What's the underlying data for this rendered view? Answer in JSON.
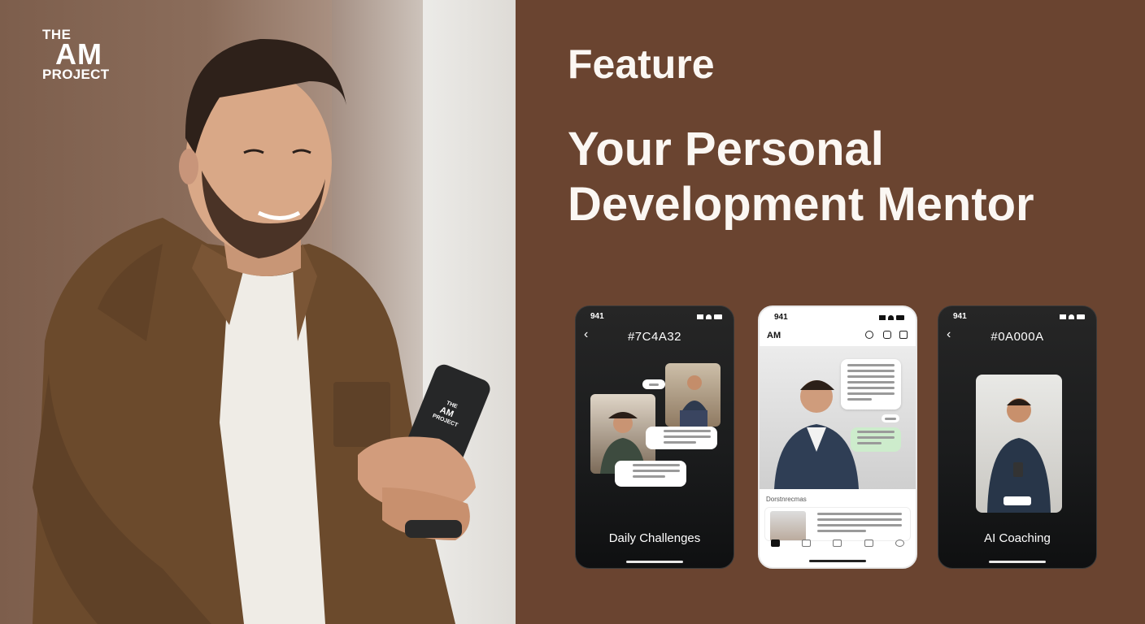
{
  "brand": {
    "line1": "THE",
    "line2": "AM",
    "line3": "PROJECT"
  },
  "phone_case_text": {
    "line1": "THE",
    "line2": "AM",
    "line3": "PROJECT"
  },
  "heading": {
    "kicker": "Feature",
    "title": "Your Personal Development Mentor"
  },
  "phones": [
    {
      "time": "941",
      "title": "#7C4A32",
      "caption": "Daily Challenges",
      "theme": "dark"
    },
    {
      "time": "941",
      "app_title": "AM",
      "section": "Dorstnrecmas",
      "theme": "light"
    },
    {
      "time": "941",
      "title": "#0A000A",
      "caption": "AI Coaching",
      "theme": "dark"
    }
  ],
  "colors": {
    "background": "#6a4430",
    "phone_dark": "#1b1c1d",
    "chat_green": "#cdeccc",
    "text": "#fbf7f3"
  },
  "icons": [
    "back-chevron-icon",
    "search-icon",
    "instagram-icon",
    "share-icon",
    "home-icon",
    "signal-icon",
    "wifi-icon",
    "battery-icon"
  ]
}
